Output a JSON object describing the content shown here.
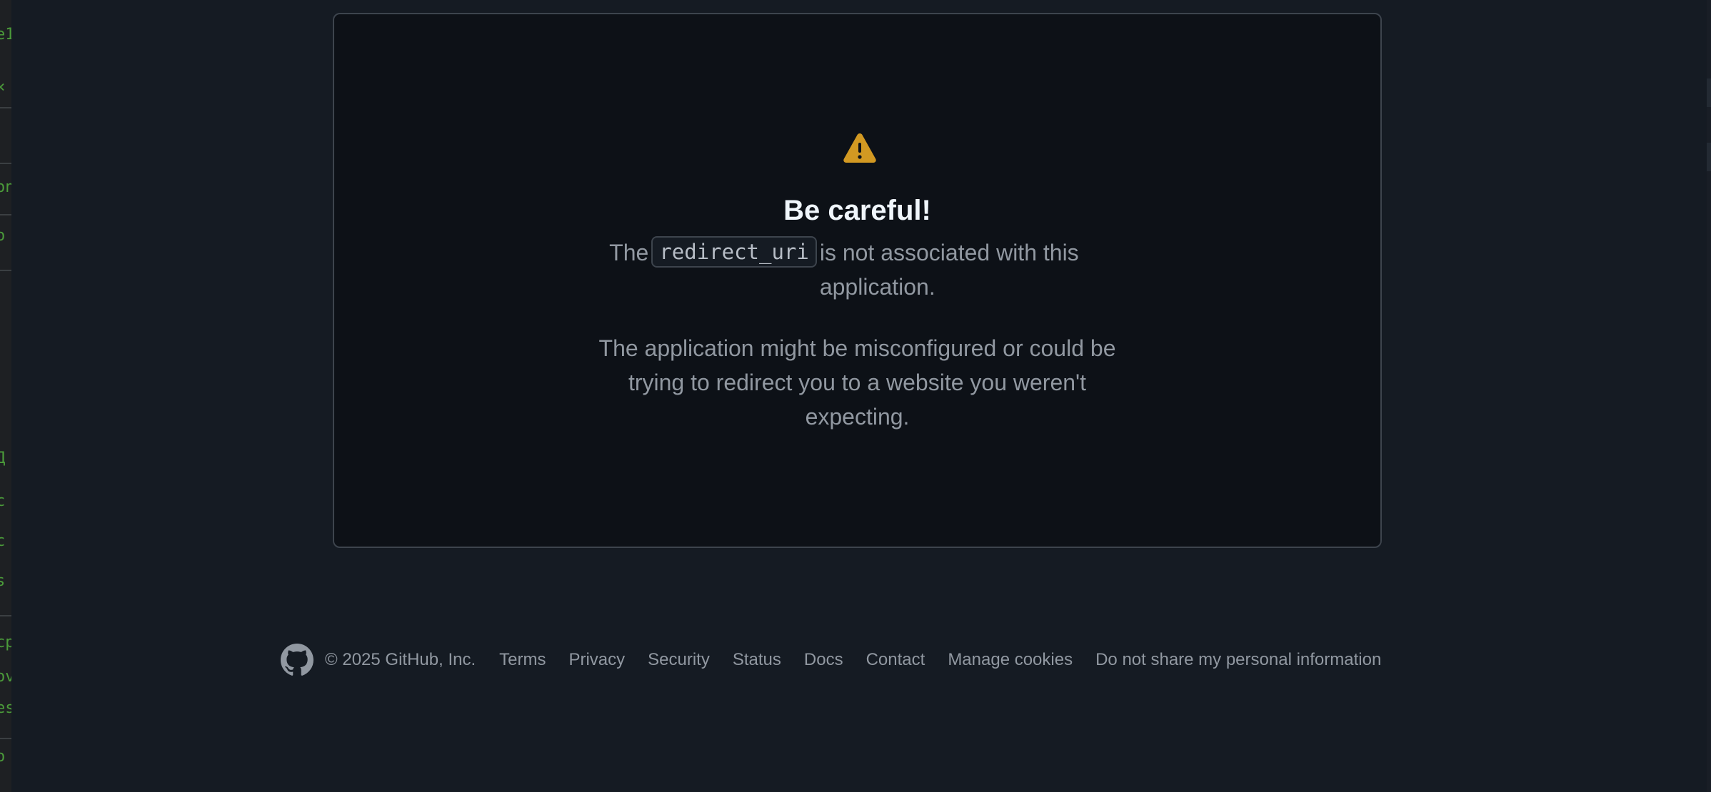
{
  "dialog": {
    "title": "Be careful!",
    "message_pre": "The",
    "code": "redirect_uri",
    "message_post": "is not associated with this application.",
    "detail": "The application might be misconfigured or could be trying to redirect you to a website you weren't expecting.",
    "icon": "alert-triangle-icon",
    "icon_color": "#d29922"
  },
  "footer": {
    "logo_icon": "github-mark-icon",
    "copyright": "© 2025 GitHub, Inc.",
    "links": [
      "Terms",
      "Privacy",
      "Security",
      "Status",
      "Docs",
      "Contact",
      "Manage cookies",
      "Do not share my personal information"
    ]
  },
  "background_window": {
    "fragments": [
      "e1",
      "×",
      "on",
      "o",
      "Д",
      "c",
      "c",
      "s",
      "cp",
      "ov",
      "es",
      "o"
    ]
  }
}
